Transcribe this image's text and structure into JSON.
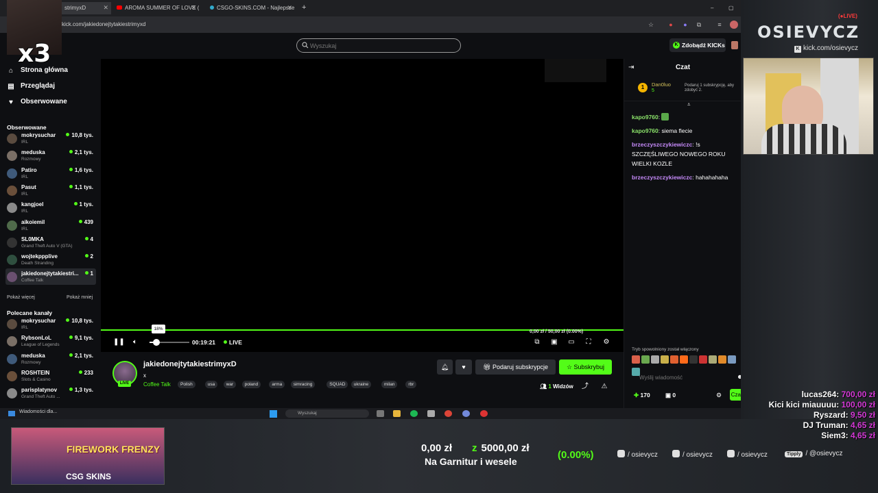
{
  "browser": {
    "tabs": [
      {
        "label": "strimyxD"
      },
      {
        "label": "AROMA SUMMER OF LOVE ( S"
      },
      {
        "label": "CSGO-SKINS.COM - Najlepsze"
      }
    ],
    "url": "kick.com/jakiedonejtytakiestrimyxd"
  },
  "header": {
    "search_placeholder": "Wyszukaj",
    "kicks_button": "Zdobądź KICKs",
    "kicks_icon": "K"
  },
  "sidebar": {
    "nav": [
      {
        "label": "Strona główna",
        "icon": "home-icon"
      },
      {
        "label": "Przeglądaj",
        "icon": "browse-icon"
      },
      {
        "label": "Obserwowane",
        "icon": "heart-icon"
      }
    ],
    "followed_title": "Obserwowane",
    "followed": [
      {
        "name": "mokrysuchar",
        "category": "IRL",
        "viewers": "10,8 tys."
      },
      {
        "name": "meduska",
        "category": "Rozmowy",
        "viewers": "2,1 tys."
      },
      {
        "name": "Patiro",
        "category": "IRL",
        "viewers": "1,6 tys."
      },
      {
        "name": "Pasut",
        "category": "IRL",
        "viewers": "1,1 tys."
      },
      {
        "name": "kangjoel",
        "category": "IRL",
        "viewers": "1 tys."
      },
      {
        "name": "aikoiemil",
        "category": "IRL",
        "viewers": "439"
      },
      {
        "name": "SL0MKA",
        "category": "Grand Theft Auto V (GTA)",
        "viewers": "4"
      },
      {
        "name": "wojtekppplive",
        "category": "Death Stranding",
        "viewers": "2"
      },
      {
        "name": "jakiedonejtytakiestri...",
        "category": "Coffee Talk",
        "viewers": "1"
      }
    ],
    "show_more": "Pokaż więcej",
    "show_less": "Pokaż mniej",
    "recommended_title": "Polecane kanały",
    "recommended": [
      {
        "name": "mokrysuchar",
        "category": "IRL",
        "viewers": "10,8 tys."
      },
      {
        "name": "RybsonLoL",
        "category": "League of Legends",
        "viewers": "9,1 tys."
      },
      {
        "name": "meduska",
        "category": "Rozmowy",
        "viewers": "2,1 tys."
      },
      {
        "name": "ROSHTEIN",
        "category": "Slots & Casino",
        "viewers": "233"
      },
      {
        "name": "parisplatynov",
        "category": "Grand Theft Auto ...",
        "viewers": "1,3 tys."
      }
    ]
  },
  "player": {
    "volume_percent": 18,
    "volume_tooltip": "18%",
    "time": "00:19:21",
    "live_label": "LIVE",
    "goal_overlay": "0,00 zł / 50,00 zł (0.00%)"
  },
  "stream": {
    "streamer": "jakiedonejtytakiestrimyxD",
    "title": "x",
    "category": "Coffee Talk",
    "live_badge": "LIVE",
    "tags": [
      "Polish",
      "usa",
      "war",
      "poland",
      "arma",
      "simracing",
      "SQUAD",
      "ukraine",
      "milan",
      "rbr"
    ],
    "gift_subs_label": "Podaruj subskrypcje",
    "subscribe_label": "Subskrybuj",
    "viewers_count": "1",
    "viewers_label": "Widzów"
  },
  "chat": {
    "title": "Czat",
    "pinned": {
      "name": "Dan0luo",
      "subs": "5",
      "info": "Podaruj 1 subskrypcję, aby zdobyć 2.",
      "rank": "1"
    },
    "messages": [
      {
        "user": "kapo9760",
        "text": "",
        "color": "#8be36a"
      },
      {
        "user": "kapo9760",
        "text": "siema flecie",
        "color": "#8be36a"
      },
      {
        "user": "brzeczyszczykiewiczc",
        "text": "!s SZCZĘŚLIWEGO NOWEGO ROKU WIELKI KOZLE",
        "color": "#c58af9"
      },
      {
        "user": "brzeczyszczykiewiczc",
        "text": "hahahahaha",
        "color": "#c58af9"
      }
    ],
    "emote_note": "Tryb spowolniony został włączony",
    "input_placeholder": "Wyślij wiadomość",
    "points": "170",
    "gifts": "0",
    "send_label": "Czat"
  },
  "taskbar": {
    "news": "Wiadomości dla...",
    "search": "Wyszukaj"
  },
  "overlay": {
    "multiplier": "x3",
    "brand": "OSIEVYCZ",
    "live_tag": "LIVE",
    "kick_url": "kick.com/osievycz",
    "donations": [
      {
        "name": "lucas264:",
        "amount": "700,00 zł"
      },
      {
        "name": "Kici kici miauuuu:",
        "amount": "100,00 zł"
      },
      {
        "name": "Ryszard:",
        "amount": "9,50 zł"
      },
      {
        "name": "DJ Truman:",
        "amount": "4,65 zł"
      },
      {
        "name": "Siem3:",
        "amount": "4,65 zł"
      }
    ],
    "promo_title": "FIREWORK FRENZY",
    "promo_logo": "CSG SKINS",
    "goal_current": "0,00 zł",
    "goal_target": "5000,00 zł",
    "goal_pct": "(0.00%)",
    "goal_name": "Na Garnitur i wesele",
    "socials": [
      {
        "icon": "instagram-icon",
        "handle": "/ osievycz"
      },
      {
        "icon": "tiktok-icon",
        "handle": "/ osievycz"
      },
      {
        "icon": "youtube-icon",
        "handle": "/ osievycz"
      },
      {
        "icon": "tipply-icon",
        "badge": "Tipply",
        "handle": "/ @osievycz"
      }
    ]
  },
  "colors": {
    "accent": "#53fc18",
    "background": "#0e0f12",
    "donation": "#d63ad8"
  }
}
